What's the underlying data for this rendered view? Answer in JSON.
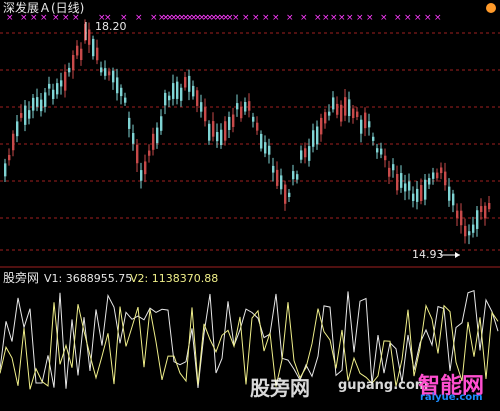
{
  "header": {
    "stock_title": "深发展Ａ(日线)"
  },
  "price_panel": {
    "high_label": "18.20",
    "low_label": "14.93",
    "markers_color": "#ff3cff",
    "up_color": "#c84a4a",
    "down_color": "#7fd4d4",
    "grid_color": "#a02020",
    "marker_glyph": "×"
  },
  "indicator_panel": {
    "name": "股旁网",
    "v1_label": "V1: 3688955.75",
    "v2_label": "V2: 1138370.88",
    "v1_color": "#e8e8e8",
    "v2_color": "#f0ef8a"
  },
  "watermark": {
    "site_cn": "股旁网",
    "site_en": "gupang.com",
    "brand": "智能网",
    "brand_url": "raiyue.com"
  }
}
